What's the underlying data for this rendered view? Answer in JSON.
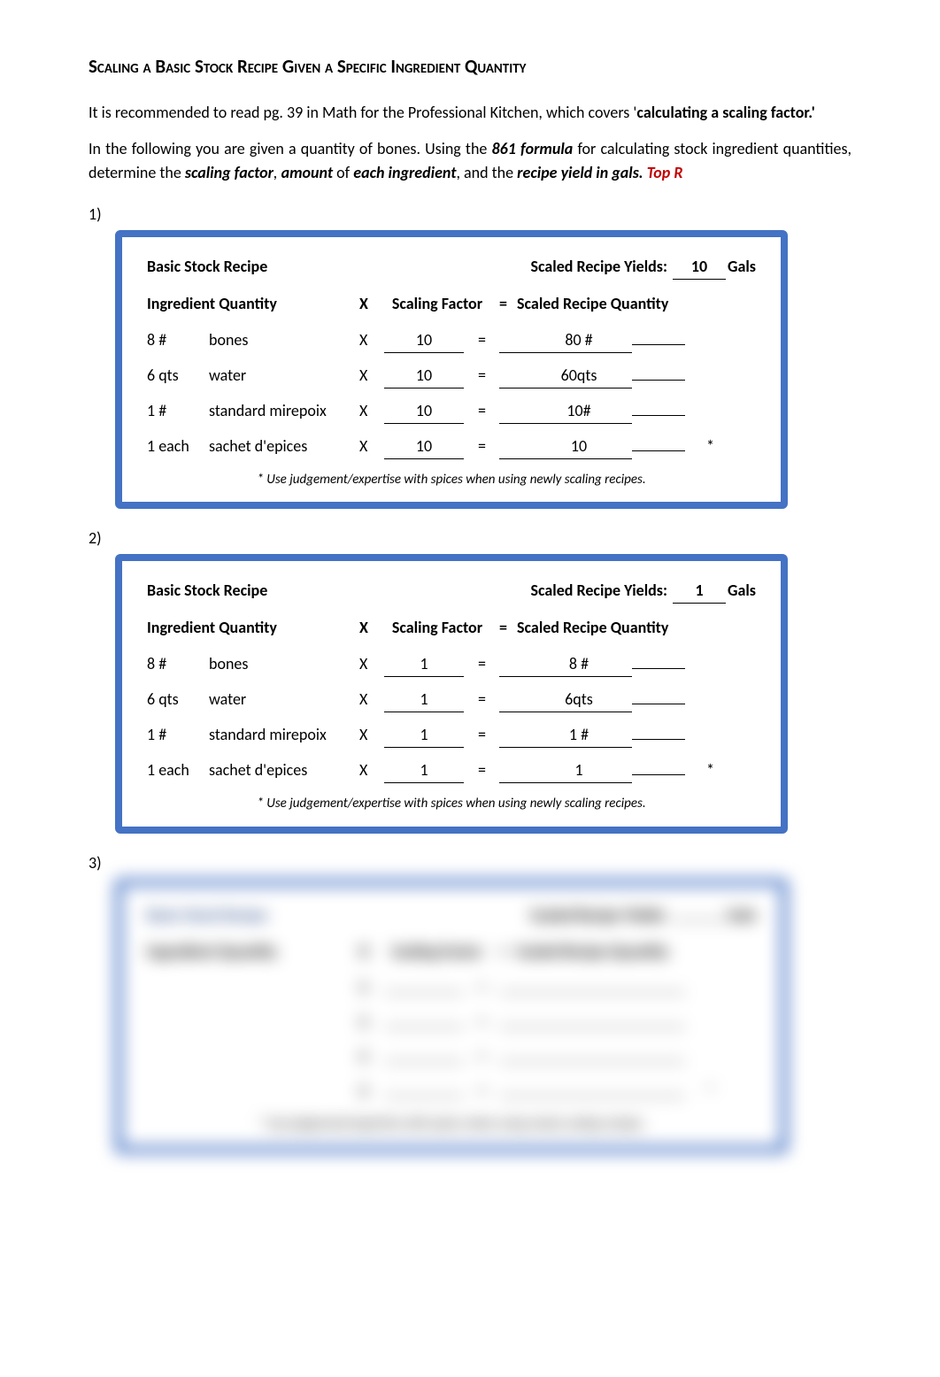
{
  "title": "Scaling a Basic Stock Recipe Given a Specific Ingredient Quantity",
  "intro": {
    "p1_a": "It is recommended to read pg. 39 in Math for the Professional Kitchen, which covers '",
    "p1_b": "calculating a scaling factor.'",
    "p2_a": "In the following you are given a quantity of bones. Using the ",
    "p2_b": "861 formula",
    "p2_c": " for calculating stock ingredient quantities, determine the ",
    "p2_d": "scaling factor",
    "p2_e": ", ",
    "p2_f": "amount",
    "p2_g": " of ",
    "p2_h": "each ingredient",
    "p2_i": ", and the ",
    "p2_j": "recipe yield in gals.",
    "p2_k": " Top R"
  },
  "labels": {
    "basic_stock_recipe": "Basic Stock Recipe",
    "scaled_recipe_yields": "Scaled Recipe Yields:",
    "gals": "Gals",
    "ingredient_quantity": "Ingredient  Quantity",
    "x": "X",
    "scaling_factor": "Scaling Factor",
    "eq": "=",
    "scaled_recipe_quantity": "Scaled Recipe Quantity",
    "footnote": "* Use judgement/expertise with spices when using newly scaling recipes."
  },
  "problems": {
    "p1": {
      "label": "1)"
    },
    "p2": {
      "label": "2)"
    },
    "p3": {
      "label": "3)"
    }
  },
  "recipe1": {
    "yield": "10",
    "rows": [
      {
        "qty": "8   #",
        "name": "bones",
        "x": "X",
        "sf": "10",
        "eq": "=",
        "result": "80 #",
        "tail": ""
      },
      {
        "qty": "6 qts",
        "name": "water",
        "x": "X",
        "sf": "10",
        "eq": "=",
        "result": "60qts",
        "tail": ""
      },
      {
        "qty": "1   #",
        "name": "standard mirepoix",
        "x": "X",
        "sf": "10",
        "eq": "=",
        "result": "10#",
        "tail": ""
      },
      {
        "qty": "1 each",
        "name": "sachet d'epices",
        "x": "X",
        "sf": "10",
        "eq": "=",
        "result": "10",
        "tail": "*"
      }
    ]
  },
  "recipe2": {
    "yield": "1",
    "rows": [
      {
        "qty": "8   #",
        "name": "bones",
        "x": "X",
        "sf": "1",
        "eq": "=",
        "result": "8 #",
        "tail": ""
      },
      {
        "qty": "6 qts",
        "name": "water",
        "x": "X",
        "sf": "1",
        "eq": "=",
        "result": "6qts",
        "tail": ""
      },
      {
        "qty": "1   #",
        "name": "standard mirepoix",
        "x": "X",
        "sf": "1",
        "eq": "=",
        "result": "1 #",
        "tail": ""
      },
      {
        "qty": "1 each",
        "name": "sachet d'epices",
        "x": "X",
        "sf": "1",
        "eq": "=",
        "result": "1",
        "tail": "*"
      }
    ]
  },
  "recipe3": {
    "yield": "",
    "rows": [
      {
        "qty": "",
        "name": "",
        "x": "X",
        "sf": "",
        "eq": "=",
        "result": "",
        "tail": ""
      },
      {
        "qty": "",
        "name": "",
        "x": "X",
        "sf": "",
        "eq": "=",
        "result": "",
        "tail": ""
      },
      {
        "qty": "",
        "name": "",
        "x": "X",
        "sf": "",
        "eq": "=",
        "result": "",
        "tail": ""
      },
      {
        "qty": "",
        "name": "",
        "x": "X",
        "sf": "",
        "eq": "=",
        "result": "",
        "tail": "*"
      }
    ]
  }
}
